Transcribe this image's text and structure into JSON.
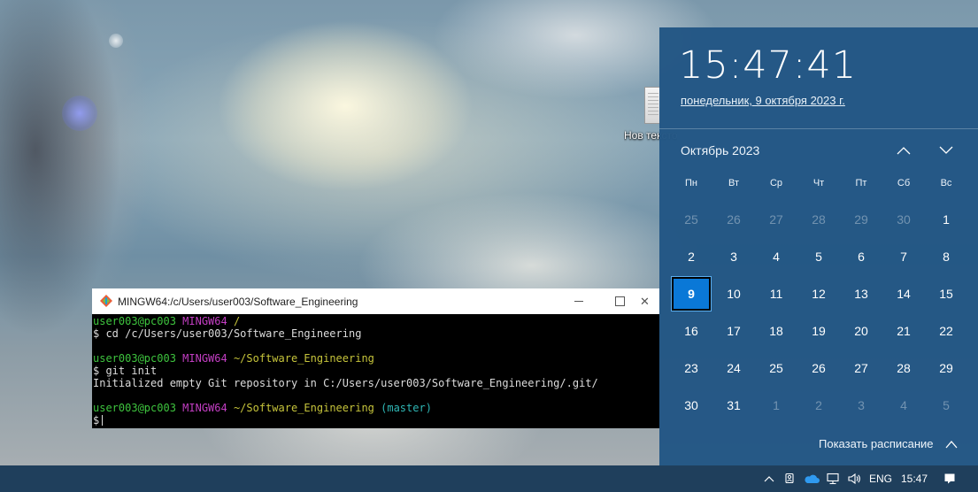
{
  "desktop": {
    "icon_label": "Нов текстов",
    "icon_name": "text-document-icon"
  },
  "terminal": {
    "title": "MINGW64:/c/Users/user003/Software_Engineering",
    "lines": [
      [
        {
          "t": "user003@pc003 ",
          "c": "green"
        },
        {
          "t": "MINGW64 ",
          "c": "magenta"
        },
        {
          "t": "/",
          "c": "yellow"
        }
      ],
      [
        {
          "t": "$ cd /c/Users/user003/Software_Engineering",
          "c": "white"
        }
      ],
      [],
      [
        {
          "t": "user003@pc003 ",
          "c": "green"
        },
        {
          "t": "MINGW64 ",
          "c": "magenta"
        },
        {
          "t": "~/Software_Engineering",
          "c": "yellow"
        }
      ],
      [
        {
          "t": "$ git init",
          "c": "white"
        }
      ],
      [
        {
          "t": "Initialized empty Git repository in C:/Users/user003/Software_Engineering/.git/",
          "c": "white"
        }
      ],
      [],
      [
        {
          "t": "user003@pc003 ",
          "c": "green"
        },
        {
          "t": "MINGW64 ",
          "c": "magenta"
        },
        {
          "t": "~/Software_Engineering",
          "c": "yellow"
        },
        {
          "t": " (master)",
          "c": "cyan"
        }
      ],
      [
        {
          "t": "$",
          "c": "white"
        }
      ]
    ]
  },
  "clock": {
    "time": "15:47:41",
    "date": "понедельник, 9 октября 2023 г."
  },
  "calendar": {
    "month_label": "Октябрь 2023",
    "weekdays": [
      "Пн",
      "Вт",
      "Ср",
      "Чт",
      "Пт",
      "Сб",
      "Вс"
    ],
    "weeks": [
      [
        {
          "d": "25",
          "o": true
        },
        {
          "d": "26",
          "o": true
        },
        {
          "d": "27",
          "o": true
        },
        {
          "d": "28",
          "o": true
        },
        {
          "d": "29",
          "o": true
        },
        {
          "d": "30",
          "o": true
        },
        {
          "d": "1"
        }
      ],
      [
        {
          "d": "2"
        },
        {
          "d": "3"
        },
        {
          "d": "4"
        },
        {
          "d": "5"
        },
        {
          "d": "6"
        },
        {
          "d": "7"
        },
        {
          "d": "8"
        }
      ],
      [
        {
          "d": "9",
          "today": true
        },
        {
          "d": "10"
        },
        {
          "d": "11"
        },
        {
          "d": "12"
        },
        {
          "d": "13"
        },
        {
          "d": "14"
        },
        {
          "d": "15"
        }
      ],
      [
        {
          "d": "16"
        },
        {
          "d": "17"
        },
        {
          "d": "18"
        },
        {
          "d": "19"
        },
        {
          "d": "20"
        },
        {
          "d": "21"
        },
        {
          "d": "22"
        }
      ],
      [
        {
          "d": "23"
        },
        {
          "d": "24"
        },
        {
          "d": "25"
        },
        {
          "d": "26"
        },
        {
          "d": "27"
        },
        {
          "d": "28"
        },
        {
          "d": "29"
        }
      ],
      [
        {
          "d": "30"
        },
        {
          "d": "31"
        },
        {
          "d": "1",
          "o": true
        },
        {
          "d": "2",
          "o": true
        },
        {
          "d": "3",
          "o": true
        },
        {
          "d": "4",
          "o": true
        },
        {
          "d": "5",
          "o": true
        }
      ]
    ],
    "show_schedule_label": "Показать расписание"
  },
  "taskbar": {
    "language": "ENG",
    "time": "15:47",
    "tray_icons": [
      "chevron-up-icon",
      "meet-now-icon",
      "onedrive-cloud-icon",
      "network-icon",
      "volume-icon",
      "notification-icon"
    ]
  },
  "colors": {
    "flyout_bg": "#225684",
    "today_highlight": "#0a78d7",
    "taskbar_bg": "#1f3f5c",
    "term_green": "#3ec43e",
    "term_magenta": "#c33ec3",
    "term_yellow": "#c6c43b",
    "term_cyan": "#2fb7b5"
  }
}
